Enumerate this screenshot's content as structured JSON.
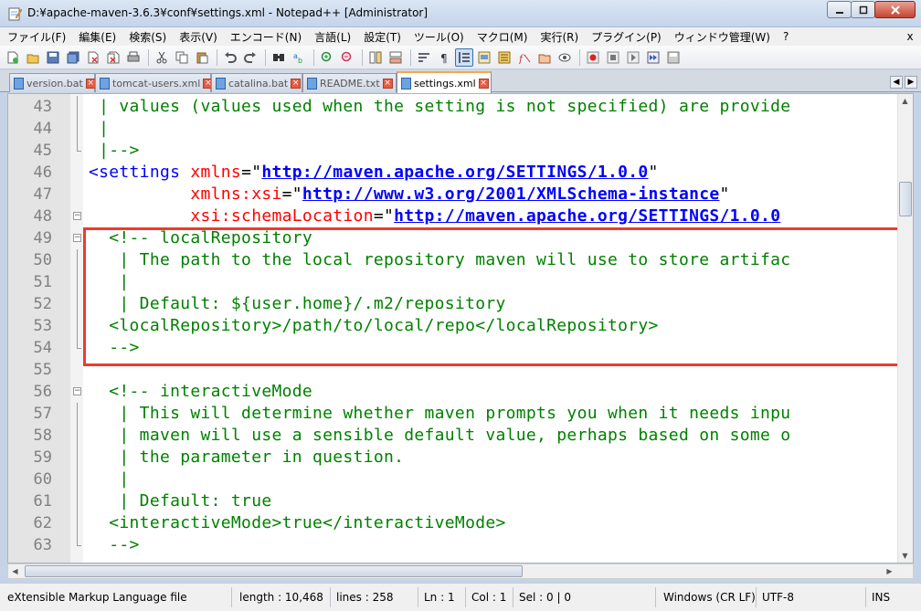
{
  "window": {
    "title": "D:¥apache-maven-3.6.3¥conf¥settings.xml - Notepad++ [Administrator]"
  },
  "menu": [
    "ファイル(F)",
    "編集(E)",
    "検索(S)",
    "表示(V)",
    "エンコード(N)",
    "言語(L)",
    "設定(T)",
    "ツール(O)",
    "マクロ(M)",
    "実行(R)",
    "プラグイン(P)",
    "ウィンドウ管理(W)",
    "?"
  ],
  "menu_close": "x",
  "tabs": [
    {
      "label": "version.bat",
      "active": false
    },
    {
      "label": "tomcat-users.xml",
      "active": false
    },
    {
      "label": "catalina.bat",
      "active": false
    },
    {
      "label": "README.txt",
      "active": false
    },
    {
      "label": "settings.xml",
      "active": true
    }
  ],
  "toolbar_icons": [
    "new-file-icon",
    "open-file-icon",
    "save-icon",
    "save-all-icon",
    "close-icon",
    "close-all-icon",
    "print-icon",
    "cut-icon",
    "copy-icon",
    "paste-icon",
    "undo-icon",
    "redo-icon",
    "find-icon",
    "replace-icon",
    "zoom-in-icon",
    "zoom-out-icon",
    "sync-v-icon",
    "sync-h-icon",
    "wrap-icon",
    "all-chars-icon",
    "indent-guide-icon",
    "doc-map-icon",
    "function-list-icon",
    "folder-workspace-icon",
    "monitor-icon",
    "record-macro-icon",
    "stop-macro-icon",
    "play-macro-icon",
    "run-macro-multiple-icon",
    "save-macro-icon"
  ],
  "editor": {
    "lines": [
      {
        "num": "43",
        "segs": [
          {
            "t": " | values (values used when the setting is not specified) are provide",
            "c": "comment"
          }
        ]
      },
      {
        "num": "44",
        "segs": [
          {
            "t": " |",
            "c": "comment"
          }
        ]
      },
      {
        "num": "45",
        "segs": [
          {
            "t": " |-->",
            "c": "comment"
          }
        ]
      },
      {
        "num": "46",
        "segs": [
          {
            "t": "<settings ",
            "c": "tag"
          },
          {
            "t": "xmlns",
            "c": "attr"
          },
          {
            "t": "=\"",
            "c": "text"
          },
          {
            "t": "http://maven.apache.org/SETTINGS/1.0.0",
            "c": "link"
          },
          {
            "t": "\"",
            "c": "text"
          }
        ]
      },
      {
        "num": "47",
        "segs": [
          {
            "t": "          xmlns:xsi",
            "c": "attr"
          },
          {
            "t": "=\"",
            "c": "text"
          },
          {
            "t": "http://www.w3.org/2001/XMLSchema-instance",
            "c": "link"
          },
          {
            "t": "\"",
            "c": "text"
          }
        ]
      },
      {
        "num": "48",
        "segs": [
          {
            "t": "          xsi:schemaLocation",
            "c": "attr"
          },
          {
            "t": "=\"",
            "c": "text"
          },
          {
            "t": "http://maven.apache.org/SETTINGS/1.0.0",
            "c": "link"
          }
        ]
      },
      {
        "num": "49",
        "segs": [
          {
            "t": "  <!-- localRepository",
            "c": "comment"
          }
        ]
      },
      {
        "num": "50",
        "segs": [
          {
            "t": "   | The path to the local repository maven will use to store artifac",
            "c": "comment"
          }
        ]
      },
      {
        "num": "51",
        "segs": [
          {
            "t": "   |",
            "c": "comment"
          }
        ]
      },
      {
        "num": "52",
        "segs": [
          {
            "t": "   | Default: ${user.home}/.m2/repository",
            "c": "comment"
          }
        ]
      },
      {
        "num": "53",
        "segs": [
          {
            "t": "  <localRepository>/path/to/local/repo</localRepository>",
            "c": "comment"
          }
        ]
      },
      {
        "num": "54",
        "segs": [
          {
            "t": "  -->",
            "c": "comment"
          }
        ]
      },
      {
        "num": "55",
        "segs": []
      },
      {
        "num": "56",
        "segs": [
          {
            "t": "  <!-- interactiveMode",
            "c": "comment"
          }
        ]
      },
      {
        "num": "57",
        "segs": [
          {
            "t": "   | This will determine whether maven prompts you when it needs inpu",
            "c": "comment"
          }
        ]
      },
      {
        "num": "58",
        "segs": [
          {
            "t": "   | maven will use a sensible default value, perhaps based on some o",
            "c": "comment"
          }
        ]
      },
      {
        "num": "59",
        "segs": [
          {
            "t": "   | the parameter in question.",
            "c": "comment"
          }
        ]
      },
      {
        "num": "60",
        "segs": [
          {
            "t": "   |",
            "c": "comment"
          }
        ]
      },
      {
        "num": "61",
        "segs": [
          {
            "t": "   | Default: true",
            "c": "comment"
          }
        ]
      },
      {
        "num": "62",
        "segs": [
          {
            "t": "  <interactiveMode>true</interactiveMode>",
            "c": "comment"
          }
        ]
      },
      {
        "num": "63",
        "segs": [
          {
            "t": "  -->",
            "c": "comment"
          }
        ]
      }
    ]
  },
  "status": {
    "file_type": "eXtensible Markup Language file",
    "length": "length : 10,468",
    "lines": "lines : 258",
    "ln": "Ln : 1",
    "col": "Col : 1",
    "sel": "Sel : 0 | 0",
    "eol": "Windows (CR LF)",
    "encoding": "UTF-8",
    "mode": "INS"
  },
  "colors": {
    "highlight_box": "#ee3a2e",
    "comment": "#008000",
    "tag": "#0000ff",
    "attr": "#ff0000",
    "link": "#0000ff"
  }
}
